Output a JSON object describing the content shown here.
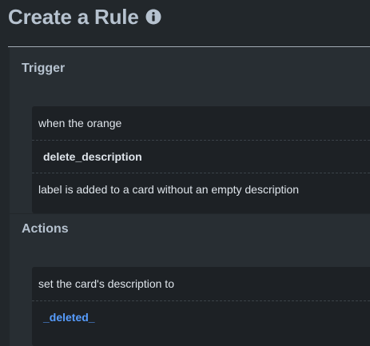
{
  "page": {
    "title": "Create a Rule",
    "info_icon": "info-icon"
  },
  "trigger": {
    "heading": "Trigger",
    "line1": "when the orange",
    "value": "delete_description",
    "line2": "label is added to a card without an empty description"
  },
  "actions": {
    "heading": "Actions",
    "line1": "set the card's description to",
    "value": "_deleted_"
  },
  "colors": {
    "background": "#22272b",
    "card": "#1d2125",
    "link": "#579dff"
  }
}
